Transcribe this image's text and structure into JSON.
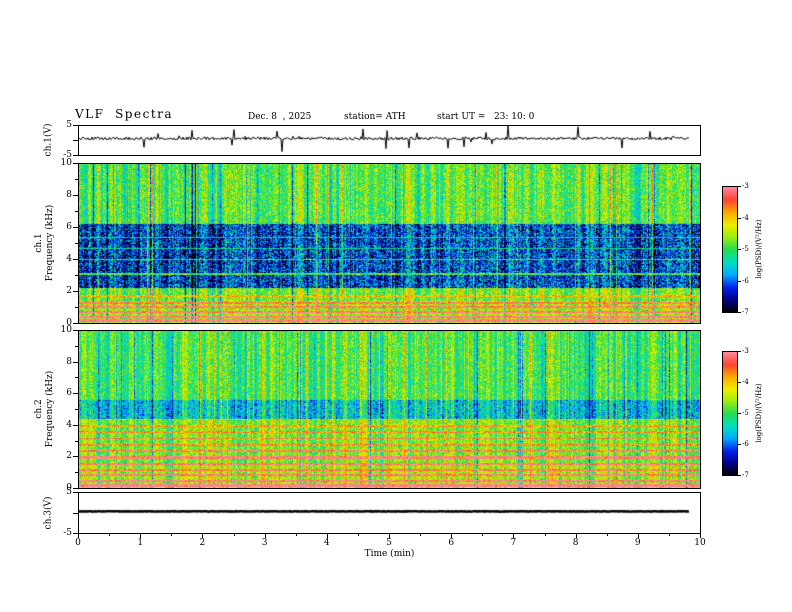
{
  "title": "VLF  Spectra",
  "header": {
    "date": "Dec. 8  , 2025",
    "station": "station= ATH",
    "start_ut": "start UT =   23: 10: 0"
  },
  "xaxis": {
    "label": "Time (min)",
    "range": [
      0,
      10
    ],
    "ticks": [
      "0",
      "1",
      "2",
      "3",
      "4",
      "5",
      "6",
      "7",
      "8",
      "9",
      "10"
    ]
  },
  "colormap": [
    "#000000",
    "#000088",
    "#0022ee",
    "#00aaff",
    "#00e0c0",
    "#22dd55",
    "#99ee11",
    "#eeee00",
    "#ffaa00",
    "#ff4433",
    "#ff8899"
  ],
  "colorbars": [
    {
      "label": "log(PSD)/(V²/Hz)",
      "ticks": [
        "-3",
        "-4",
        "-5",
        "-6",
        "-7"
      ],
      "range": [
        -7,
        -3
      ]
    },
    {
      "label": "log(PSD)/(V²/Hz)",
      "ticks": [
        "-3",
        "-4",
        "-5",
        "-6",
        "-7"
      ],
      "range": [
        -7,
        -3
      ]
    }
  ],
  "chart_data": [
    {
      "name": "ch1-waveform",
      "type": "line",
      "ylabel": "ch.1(V)",
      "ylim": [
        -5,
        5
      ],
      "yticks": {
        "values": [
          5,
          0,
          -5
        ],
        "labels": [
          "5",
          "",
          "-5"
        ]
      },
      "xlim": [
        0,
        10
      ],
      "baseline": 0.7,
      "noise": 0.5,
      "spike_rate": 0.04,
      "spike_amp": 4.5,
      "line_width": 1,
      "end_frac": 0.985,
      "seed": 5,
      "description": "Noisy broadband time series near +0.7 V with frequent impulsive spikes toward +/-5 V"
    },
    {
      "name": "ch1-spectrogram",
      "type": "heatmap",
      "ylabel1": "ch.1",
      "ylabel2": "Frequency (kHz)",
      "ylim": [
        0,
        10
      ],
      "fmax": 10,
      "yticks": {
        "values": [
          0,
          2,
          4,
          6,
          8,
          10
        ],
        "labels": [
          "0",
          "2",
          "4",
          "6",
          "8",
          "10"
        ],
        "minor_step": 1
      },
      "xlim": [
        0,
        10
      ],
      "zlabel": "log(PSD)/(V²/Hz)",
      "zlim": [
        -7,
        -3
      ],
      "seed": 11,
      "base": -4.7,
      "streak": 0.85,
      "noise": 0.55,
      "bands": [
        {
          "f": [
            2.2,
            6.2
          ],
          "delta": -1.45,
          "noise": 0.85
        },
        {
          "f": [
            6.2,
            10
          ],
          "delta": -0.15
        },
        {
          "f": [
            0,
            1.4
          ],
          "delta": 0.25
        }
      ],
      "hlines": [
        {
          "f": 0.15,
          "delta": 2.4,
          "w": 0.08
        },
        {
          "f": 0.4,
          "delta": 2.0,
          "w": 0.06
        },
        {
          "f": 0.7,
          "delta": 1.7,
          "w": 0.06
        },
        {
          "f": 1.0,
          "delta": 1.4,
          "w": 0.05
        },
        {
          "f": 1.25,
          "delta": 1.1,
          "w": 0.05
        },
        {
          "f": 1.7,
          "delta": 0.8,
          "w": 0.04
        },
        {
          "f": 3.1,
          "delta": 1.3,
          "w": 0.05
        },
        {
          "f": 4.0,
          "delta": 1.1,
          "w": 0.05
        },
        {
          "f": 4.7,
          "delta": 0.9,
          "w": 0.04
        },
        {
          "f": 5.4,
          "delta": 0.8,
          "w": 0.04
        }
      ],
      "description": "0-10 kHz spectrogram: green/cyan background with dense vertical broadband sferic streaks, suppressed dark-blue/black band from ~2.5-6 kHz, strong red/orange narrowband lines below ~1.5 kHz"
    },
    {
      "name": "ch2-spectrogram",
      "type": "heatmap",
      "ylabel1": "ch.2",
      "ylabel2": "Frequency (kHz)",
      "ylim": [
        0,
        10
      ],
      "fmax": 10,
      "yticks": {
        "values": [
          0,
          2,
          4,
          6,
          8,
          10
        ],
        "labels": [
          "0",
          "2",
          "4",
          "6",
          "8",
          "10"
        ],
        "minor_step": 1
      },
      "xlim": [
        0,
        10
      ],
      "zlabel": "log(PSD)/(V²/Hz)",
      "zlim": [
        -7,
        -3
      ],
      "seed": 23,
      "base": -4.65,
      "streak": 0.7,
      "noise": 0.5,
      "bands": [
        {
          "f": [
            5.6,
            10
          ],
          "delta": -0.25
        },
        {
          "f": [
            4.4,
            5.6
          ],
          "delta": -0.85,
          "noise": 0.6
        },
        {
          "f": [
            0,
            1.6
          ],
          "delta": 0.2
        }
      ],
      "hlines": [
        {
          "f": 0.15,
          "delta": 2.3,
          "w": 0.08
        },
        {
          "f": 0.45,
          "delta": 1.9,
          "w": 0.06
        },
        {
          "f": 0.8,
          "delta": 1.5,
          "w": 0.06
        },
        {
          "f": 1.15,
          "delta": 1.2,
          "w": 0.05
        },
        {
          "f": 1.55,
          "delta": 1.6,
          "w": 0.07
        },
        {
          "f": 1.95,
          "delta": 1.8,
          "w": 0.08
        },
        {
          "f": 2.35,
          "delta": 1.4,
          "w": 0.06
        },
        {
          "f": 2.75,
          "delta": 1.1,
          "w": 0.05
        },
        {
          "f": 3.15,
          "delta": 1.2,
          "w": 0.05
        },
        {
          "f": 3.55,
          "delta": 1.0,
          "w": 0.05
        },
        {
          "f": 3.95,
          "delta": 0.9,
          "w": 0.04
        },
        {
          "f": 4.35,
          "delta": 0.7,
          "w": 0.04
        }
      ],
      "description": "0-10 kHz spectrogram: green background with vertical sferic streaks above ~5 kHz, cyan-blue band ~4.4-5.6 kHz, many yellow/orange horizontal narrowband stripes below ~4.5 kHz and red lines near 0 kHz"
    },
    {
      "name": "ch3-waveform",
      "type": "line",
      "ylabel": "ch.3(V)",
      "ylim": [
        -5,
        5
      ],
      "yticks": {
        "values": [
          5,
          0,
          -5
        ],
        "labels": [
          "5",
          "",
          "-5"
        ]
      },
      "xlim": [
        0,
        10
      ],
      "baseline": 0.4,
      "noise": 0.06,
      "spike_rate": 0,
      "spike_amp": 0,
      "line_width": 2.5,
      "end_frac": 0.985,
      "seed": 9,
      "description": "Flat constant level near +0.4 V (no signal), thick black trace ending at ~9.75 min"
    }
  ]
}
